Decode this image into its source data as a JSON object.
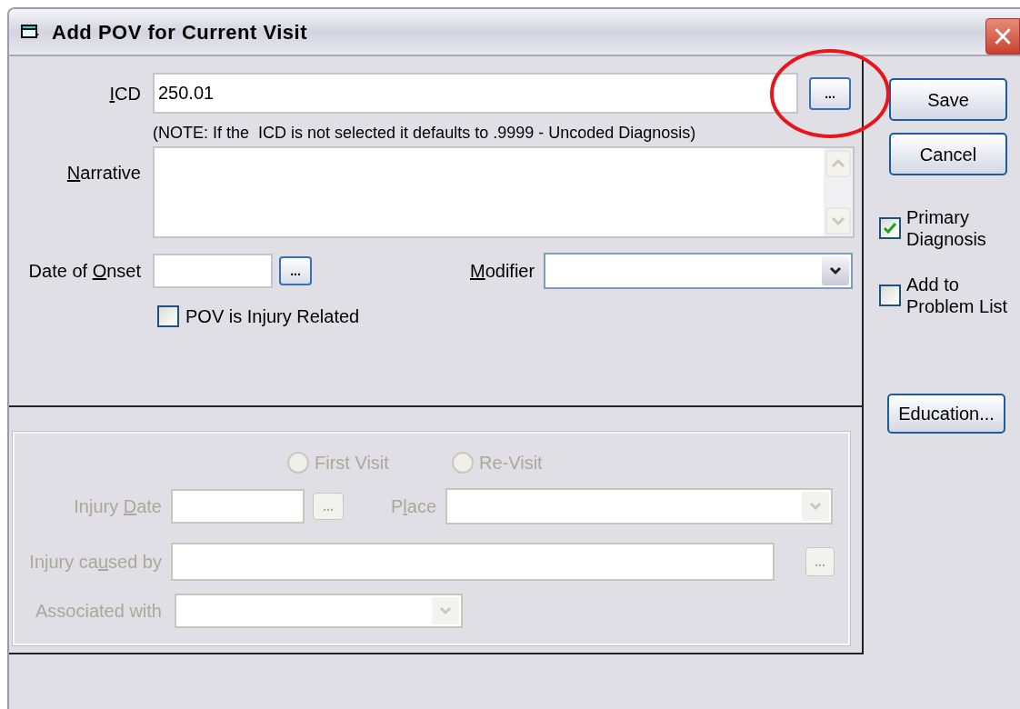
{
  "window": {
    "title": "Add POV for Current Visit",
    "close_button": "×"
  },
  "icd": {
    "label": {
      "key": "I",
      "post": "CD"
    },
    "value": "250.01",
    "lookup_button": "...",
    "note": "(NOTE: If the  ICD is not selected it defaults to .9999 - Uncoded Diagnosis)"
  },
  "narrative": {
    "label": {
      "key": "N",
      "post": "arrative"
    }
  },
  "date_of_onset": {
    "label": {
      "pre": "Date of ",
      "key": "O",
      "post": "nset"
    },
    "button": "..."
  },
  "modifier": {
    "label": {
      "key": "M",
      "post": "odifier"
    }
  },
  "injury_related": {
    "label": "POV is Injury Related",
    "checked": false
  },
  "buttons": [
    {
      "label": "Save"
    },
    {
      "label": "Cancel"
    }
  ],
  "options": [
    {
      "label": "Primary Diagnosis",
      "checked": true
    },
    {
      "label": "Add to Problem List",
      "checked": false
    }
  ],
  "education_button": "Education...",
  "injury": {
    "disabled": true,
    "visit_types": [
      {
        "label": "First Visit",
        "selected": false
      },
      {
        "label": "Re-Visit",
        "selected": false
      }
    ],
    "injury_date": {
      "label": {
        "pre": "Injury ",
        "key": "D",
        "post": "ate"
      },
      "button": "..."
    },
    "place": {
      "label": {
        "pre": "P",
        "key": "l",
        "post": "ace"
      }
    },
    "caused_by": {
      "label": {
        "pre": "Injury ca",
        "key": "u",
        "post": "sed by"
      },
      "button": "..."
    },
    "associated_with": {
      "label": {
        "pre": "Associated with"
      }
    }
  }
}
